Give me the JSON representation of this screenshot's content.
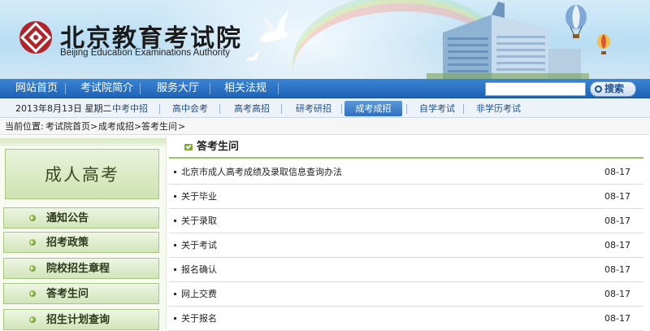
{
  "site": {
    "logo_cn": "北京教育考试院",
    "logo_en": "Beijing Education Examinations Authority"
  },
  "main_nav": [
    {
      "label": "网站首页"
    },
    {
      "label": "考试院简介"
    },
    {
      "label": "服务大厅"
    },
    {
      "label": "相关法规"
    }
  ],
  "search": {
    "value": "",
    "button_label": "搜索"
  },
  "sub_nav": {
    "date": "2013年8月13日 星期二",
    "items": [
      {
        "label": "中考中招"
      },
      {
        "label": "高中会考"
      },
      {
        "label": "高考高招"
      },
      {
        "label": "研考研招"
      },
      {
        "label": "成考成招",
        "active": true
      },
      {
        "label": "自学考试"
      },
      {
        "label": "非学历考试"
      }
    ]
  },
  "breadcrumb": {
    "prefix": "当前位置:",
    "items": [
      "考试院首页",
      "成考成招",
      "答考生问"
    ],
    "separator": ">"
  },
  "sidebar": {
    "title": "成人高考",
    "items": [
      {
        "label": "通知公告"
      },
      {
        "label": "招考政策"
      },
      {
        "label": "院校招生章程"
      },
      {
        "label": "答考生问"
      },
      {
        "label": "招生计划查询"
      }
    ]
  },
  "content": {
    "section_title": "答考生问",
    "articles": [
      {
        "title": "北京市成人高考成绩及录取信息查询办法",
        "date": "08-17"
      },
      {
        "title": "关于毕业",
        "date": "08-17"
      },
      {
        "title": "关于录取",
        "date": "08-17"
      },
      {
        "title": "关于考试",
        "date": "08-17"
      },
      {
        "title": "报名确认",
        "date": "08-17"
      },
      {
        "title": "网上交费",
        "date": "08-17"
      },
      {
        "title": "关于报名",
        "date": "08-17"
      }
    ]
  },
  "colors": {
    "nav_blue": "#1f63b6",
    "sidebar_green": "#a9c584",
    "accent_green": "#7aaa2c"
  }
}
